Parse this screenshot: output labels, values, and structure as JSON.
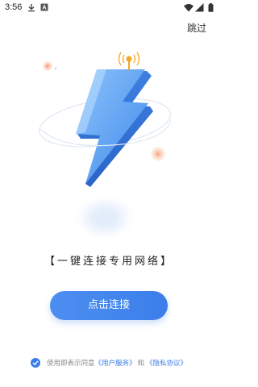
{
  "status_bar": {
    "time": "3:56",
    "icons": [
      "download-icon",
      "notification-a-icon",
      "wifi-icon",
      "signal-icon",
      "battery-icon"
    ]
  },
  "header": {
    "skip_label": "跳过"
  },
  "hero": {
    "illustration": "lightning-bolt-with-antenna",
    "colors": {
      "bolt_light": "#7ab8f7",
      "bolt_mid": "#4a90ee",
      "bolt_dark": "#2f6fd6",
      "antenna": "#f5a623",
      "orbs": "#f8a27a"
    }
  },
  "main": {
    "slogan": "【一键连接专用网络】",
    "connect_label": "点击连接"
  },
  "agreement": {
    "checked": true,
    "prefix": "使用即表示同意",
    "user_service_link": "《用户服务》",
    "and_text": "和",
    "privacy_link": "《隐私协议》"
  },
  "theme": {
    "accent": "#3b7eea"
  }
}
